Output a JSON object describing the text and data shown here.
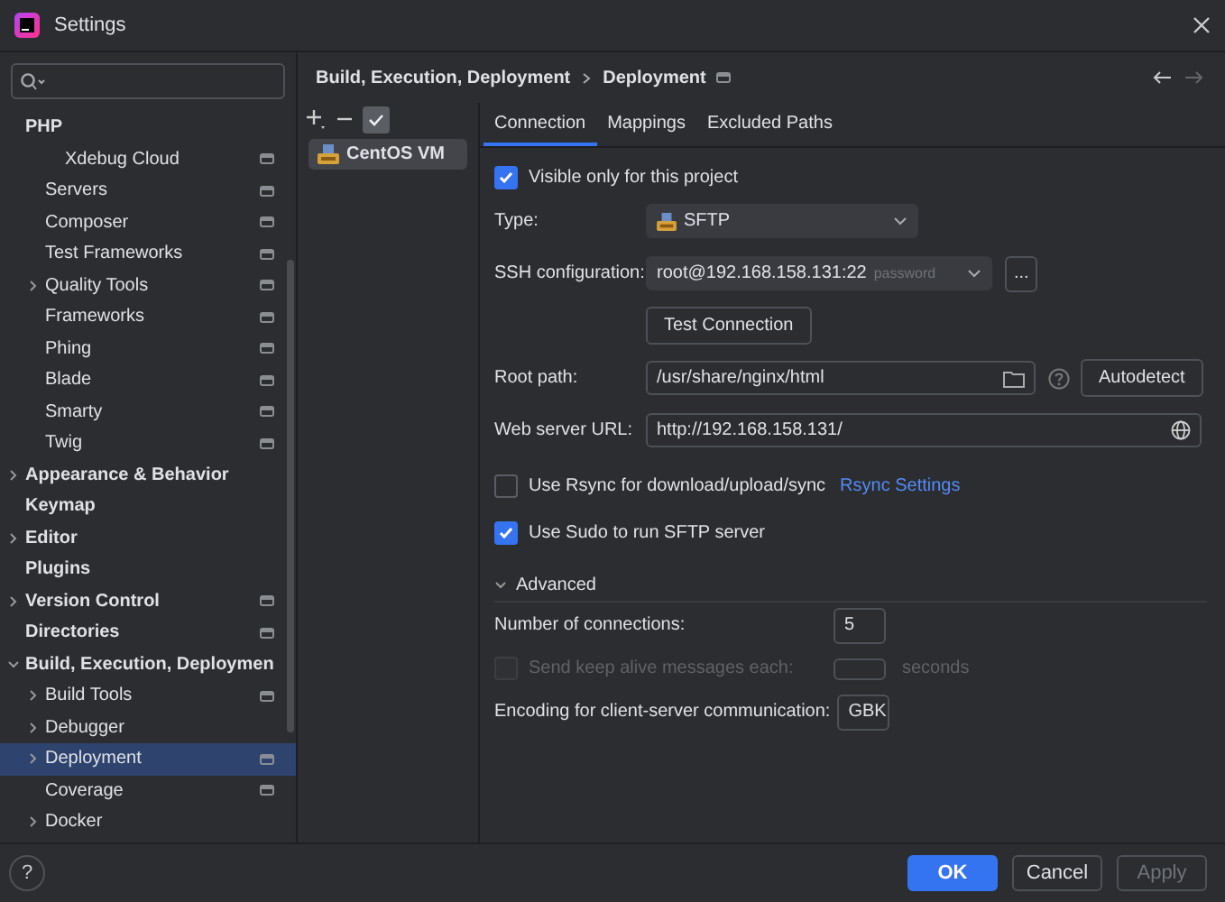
{
  "window": {
    "title": "Settings"
  },
  "sidebar": {
    "items": [
      {
        "label": "PHP",
        "selected": false,
        "children": [
          {
            "children": [
              {
                "label": "Xdebug Cloud",
                "selected": false,
                "project_scope": true
              }
            ]
          },
          {
            "label": "Servers",
            "selected": false,
            "project_scope": true
          },
          {
            "label": "Composer",
            "selected": false,
            "project_scope": true
          },
          {
            "label": "Test Frameworks",
            "selected": false,
            "project_scope": true
          },
          {
            "label": "Quality Tools",
            "selected": false,
            "expanded": false,
            "project_scope": true
          },
          {
            "label": "Frameworks",
            "selected": false,
            "project_scope": true
          },
          {
            "label": "Phing",
            "selected": false,
            "project_scope": true
          },
          {
            "label": "Blade",
            "selected": false,
            "project_scope": true
          },
          {
            "label": "Smarty",
            "selected": false,
            "project_scope": true
          },
          {
            "label": "Twig",
            "selected": false,
            "project_scope": true
          }
        ]
      },
      {
        "label": "Appearance & Behavior",
        "selected": false,
        "expanded": false
      },
      {
        "label": "Keymap",
        "selected": false
      },
      {
        "label": "Editor",
        "selected": false,
        "expanded": false
      },
      {
        "label": "Plugins",
        "selected": false
      },
      {
        "label": "Version Control",
        "selected": false,
        "expanded": false,
        "project_scope": true
      },
      {
        "label": "Directories",
        "selected": false,
        "project_scope": true
      },
      {
        "label": "Build, Execution, Deploymen",
        "selected": false,
        "expanded": true,
        "children": [
          {
            "label": "Build Tools",
            "selected": false,
            "expanded": false,
            "project_scope": true
          },
          {
            "label": "Debugger",
            "selected": false,
            "expanded": false
          },
          {
            "label": "Deployment",
            "selected": true,
            "expanded": false,
            "project_scope": true
          },
          {
            "label": "Coverage",
            "selected": false,
            "project_scope": true
          },
          {
            "label": "Docker",
            "selected": false,
            "expanded": false
          }
        ]
      }
    ]
  },
  "breadcrumb": {
    "items": [
      "Build, Execution, Deployment",
      "Deployment"
    ],
    "project_scope": true
  },
  "servers": [
    {
      "name": "CentOS VM",
      "selected": true
    }
  ],
  "tabs": [
    {
      "label": "Connection",
      "selected": true
    },
    {
      "label": "Mappings",
      "selected": false
    },
    {
      "label": "Excluded Paths",
      "selected": false
    }
  ],
  "form": {
    "visible_only": {
      "label": "Visible only for this project",
      "checked": true
    },
    "type": {
      "label": "Type:",
      "value": "SFTP"
    },
    "ssh": {
      "label": "SSH configuration:",
      "value": "root@192.168.158.131:22",
      "hint": "password",
      "more": "..."
    },
    "test_button": "Test Connection",
    "root_path": {
      "label": "Root path:",
      "value": "/usr/share/nginx/html",
      "button": "Autodetect"
    },
    "web_url": {
      "label": "Web server URL:",
      "value": "http://192.168.158.131/"
    },
    "rsync": {
      "label": "Use Rsync for download/upload/sync",
      "checked": false,
      "link": "Rsync Settings"
    },
    "sudo": {
      "label": "Use Sudo to run SFTP server",
      "checked": true
    },
    "advanced": {
      "label": "Advanced",
      "expanded": true
    },
    "connections": {
      "label": "Number of connections:",
      "value": "5"
    },
    "keep_alive": {
      "label": "Send keep alive messages each:",
      "checked": false,
      "disabled": true,
      "unit": "seconds"
    },
    "encoding": {
      "label": "Encoding for client-server communication:",
      "value": "GBK"
    }
  },
  "buttons": [
    {
      "label": "OK",
      "kind": "primary",
      "disabled": false
    },
    {
      "label": "Cancel",
      "kind": "normal",
      "disabled": false
    },
    {
      "label": "Apply",
      "kind": "normal",
      "disabled": true
    }
  ],
  "help": "?"
}
